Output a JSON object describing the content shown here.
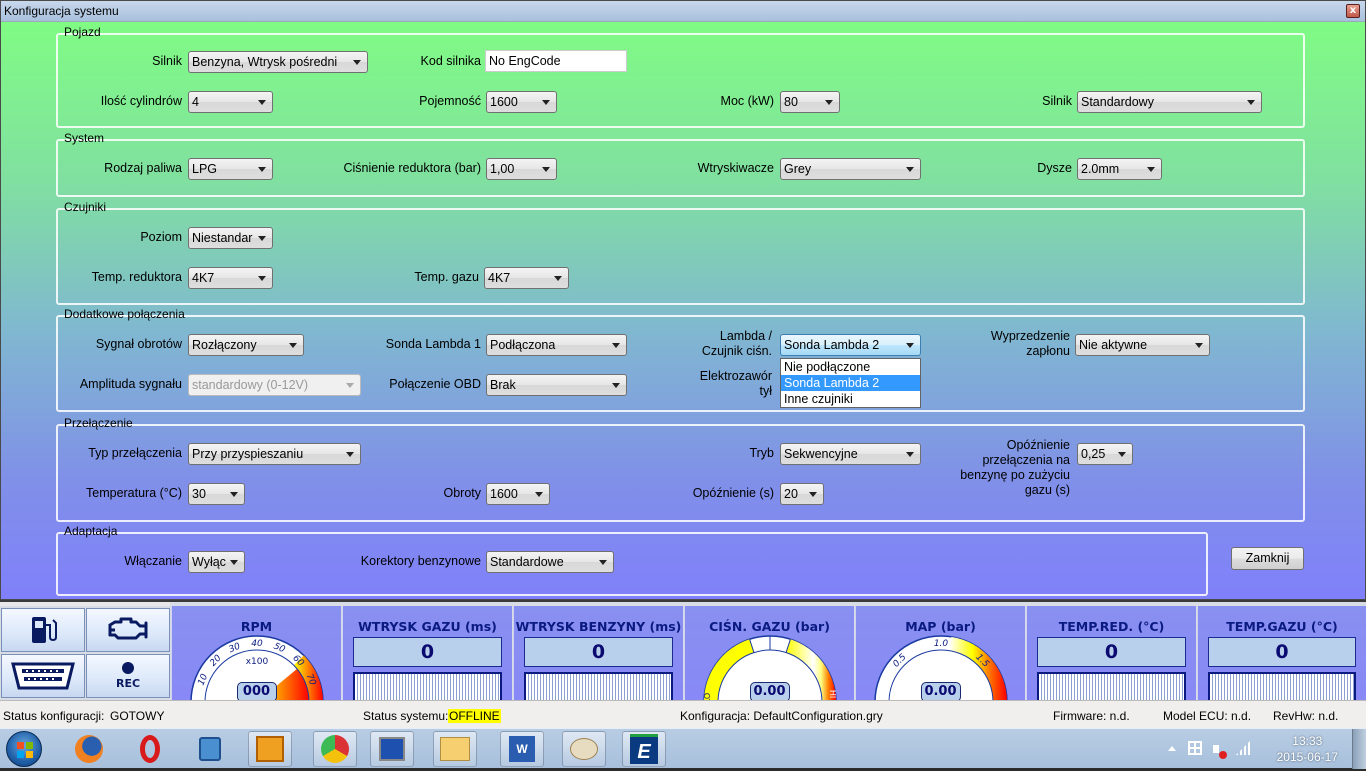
{
  "window": {
    "title": "Konfiguracja systemu",
    "close_icon": "close-icon"
  },
  "groups": {
    "pojazd": {
      "legend": "Pojazd",
      "silnik_type": {
        "label": "Silnik",
        "value": "Benzyna, Wtrysk pośredni"
      },
      "kod_silnika": {
        "label": "Kod silnika",
        "value": "No EngCode"
      },
      "cylindry": {
        "label": "Ilość cylindrów",
        "value": "4"
      },
      "pojemnosc": {
        "label": "Pojemność",
        "value": "1600"
      },
      "moc": {
        "label": "Moc (kW)",
        "value": "80"
      },
      "silnik_variant": {
        "label": "Silnik",
        "value": "Standardowy"
      }
    },
    "system": {
      "legend": "System",
      "paliwo": {
        "label": "Rodzaj paliwa",
        "value": "LPG"
      },
      "cisnienie": {
        "label": "Ciśnienie reduktora (bar)",
        "value": "1,00"
      },
      "wtryskiwacze": {
        "label": "Wtryskiwacze",
        "value": "Grey"
      },
      "dysze": {
        "label": "Dysze",
        "value": "2.0mm"
      }
    },
    "czujniki": {
      "legend": "Czujniki",
      "poziom": {
        "label": "Poziom",
        "value": "Niestandar"
      },
      "temp_reduktora": {
        "label": "Temp. reduktora",
        "value": "4K7"
      },
      "temp_gazu": {
        "label": "Temp. gazu",
        "value": "4K7"
      }
    },
    "dodatkowe": {
      "legend": "Dodatkowe połączenia",
      "sygnal_obrotow": {
        "label": "Sygnał obrotów",
        "value": "Rozłączony"
      },
      "sonda_lambda1": {
        "label": "Sonda Lambda 1",
        "value": "Podłączona"
      },
      "lambda_czujnik": {
        "label_line1": "Lambda /",
        "label_line2": "Czujnik ciśn.",
        "value": "Sonda Lambda 2",
        "options": [
          "Nie podłączone",
          "Sonda Lambda 2",
          "Inne czujniki"
        ],
        "highlighted": "Sonda Lambda 2"
      },
      "wyprzedzenie": {
        "label_line1": "Wyprzedzenie",
        "label_line2": "zapłonu",
        "value": "Nie aktywne"
      },
      "amplituda": {
        "label": "Amplituda sygnału",
        "value": "standardowy (0-12V)",
        "disabled": true
      },
      "obd": {
        "label": "Połączenie OBD",
        "value": "Brak"
      },
      "elektrozawor": {
        "label_line1": "Elektrozawór",
        "label_line2": "tył"
      }
    },
    "przelaczenie": {
      "legend": "Przełączenie",
      "typ": {
        "label": "Typ przełączenia",
        "value": "Przy przyspieszaniu"
      },
      "tryb": {
        "label": "Tryb",
        "value": "Sekwencyjne"
      },
      "opoznienie_benz": {
        "label_lines": [
          "Opóźnienie",
          "przełączenia na",
          "benzynę po zużyciu",
          "gazu (s)"
        ],
        "value": "0,25"
      },
      "temperatura": {
        "label": "Temperatura (°C)",
        "value": "30"
      },
      "obroty": {
        "label": "Obroty",
        "value": "1600"
      },
      "opoznienie": {
        "label": "Opóźnienie (s)",
        "value": "20"
      }
    },
    "adaptacja": {
      "legend": "Adaptacja",
      "wlaczanie": {
        "label": "Włączanie",
        "value": "Wyłąc"
      },
      "korektory": {
        "label": "Korektory benzynowe",
        "value": "Standardowe"
      }
    }
  },
  "buttons": {
    "zamknij": "Zamknij"
  },
  "dashboard": {
    "quick_buttons": [
      {
        "icon": "fuel-pump-icon"
      },
      {
        "icon": "check-engine-icon"
      },
      {
        "icon": "obd-connector-icon"
      },
      {
        "icon": "record-icon",
        "label": "REC"
      }
    ],
    "rpm": {
      "title": "RPM",
      "unit": "x100",
      "ticks": [
        "10",
        "20",
        "30",
        "40",
        "50",
        "60",
        "70"
      ],
      "readout": "000"
    },
    "wtrysk_gazu": {
      "title": "WTRYSK GAZU (ms)",
      "value": "0"
    },
    "wtrysk_benzyny": {
      "title": "WTRYSK BENZYNY (ms)",
      "value": "0"
    },
    "cisn_gazu": {
      "title": "CIŚN. GAZU (bar)",
      "lo": "LO",
      "hi": "HI",
      "readout": "0.00"
    },
    "map": {
      "title": "MAP (bar)",
      "ticks": [
        "0.5",
        "1.0",
        "1.5"
      ],
      "readout": "0.00"
    },
    "temp_red": {
      "title": "TEMP.RED. (°C)",
      "value": "0"
    },
    "temp_gazu": {
      "title": "TEMP.GAZU (°C)",
      "value": "0"
    }
  },
  "status": {
    "konfig_label": "Status konfiguracji:",
    "konfig_value": "GOTOWY",
    "system_label": "Status systemu:",
    "system_value": "OFFLINE",
    "konfiguracja": "Konfiguracja: DefaultConfiguration.gry",
    "firmware": "Firmware: n.d.",
    "model_ecu": "Model ECU: n.d.",
    "revhw": "RevHw: n.d."
  },
  "taskbar": {
    "apps": [
      "firefox-icon",
      "opera-icon",
      "media-player-icon",
      "outlook-icon",
      "chrome-icon",
      "remote-desktop-icon",
      "file-explorer-icon",
      "word-icon",
      "paint-icon",
      "e-gas-app-icon"
    ],
    "time": "13:33",
    "date": "2015-06-17"
  },
  "colors": {
    "highlight": "#3399ff",
    "offline_badge": "#ffff00",
    "dash_title": "#0a1a80"
  }
}
